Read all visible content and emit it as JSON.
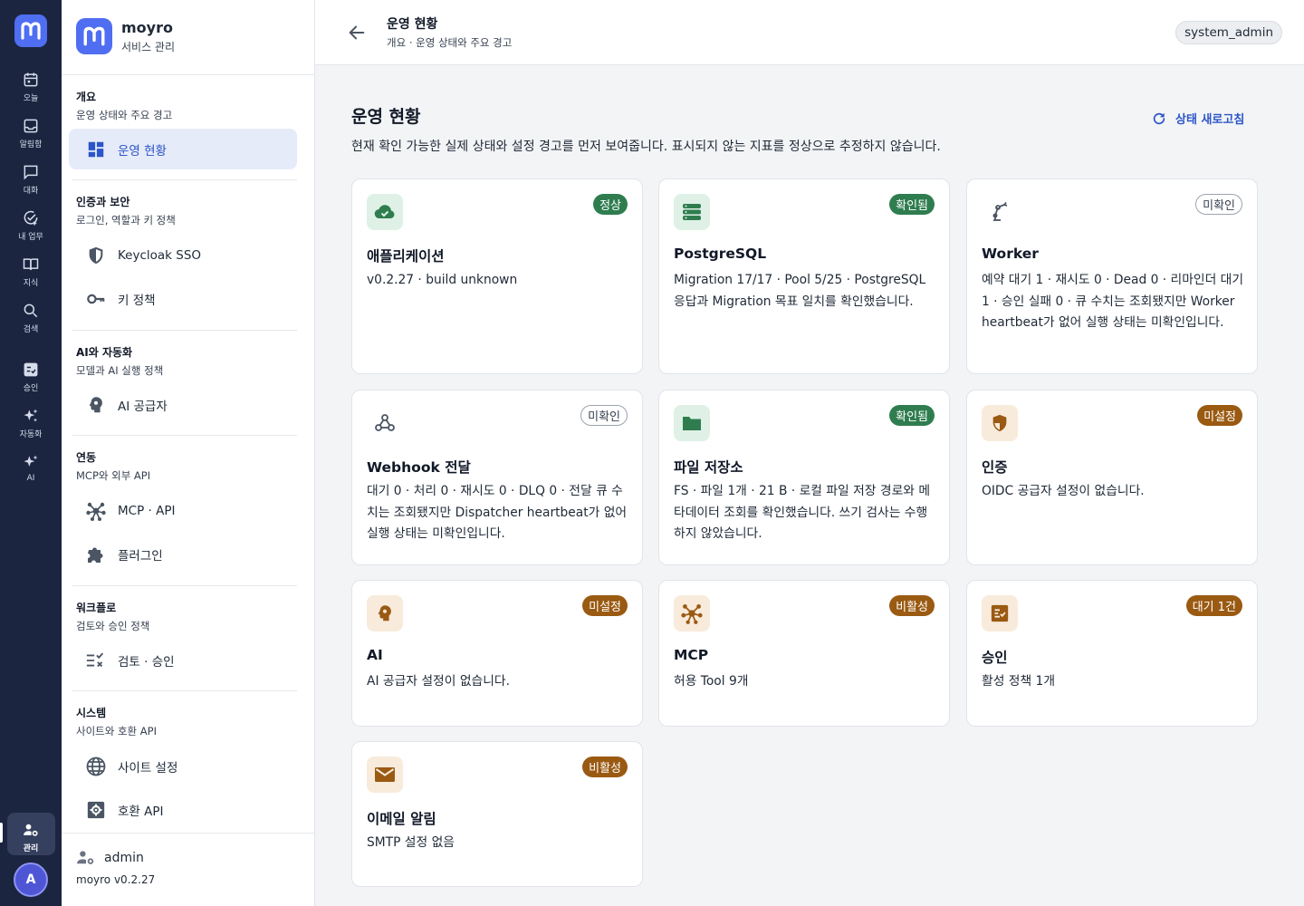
{
  "rail": {
    "items": [
      {
        "label": "오늘",
        "icon": "calendar-icon"
      },
      {
        "label": "알림함",
        "icon": "inbox-icon"
      },
      {
        "label": "대화",
        "icon": "chat-icon"
      },
      {
        "label": "내 업무",
        "icon": "task-check-icon"
      },
      {
        "label": "지식",
        "icon": "book-icon"
      },
      {
        "label": "검색",
        "icon": "search-icon"
      },
      {
        "label": "승인",
        "icon": "approval-icon"
      },
      {
        "label": "자동화",
        "icon": "sparkles-icon"
      },
      {
        "label": "AI",
        "icon": "ai-sparkle-icon"
      },
      {
        "label": "관리",
        "icon": "admin-gear-icon"
      }
    ],
    "avatar_letter": "A"
  },
  "sidebar": {
    "brand_name": "moyro",
    "brand_sub": "서비스 관리",
    "sections": [
      {
        "title": "개요",
        "sub": "운영 상태와 주요 경고",
        "items": [
          {
            "label": "운영 현황",
            "icon": "dashboard-icon",
            "active": true
          }
        ]
      },
      {
        "title": "인증과 보안",
        "sub": "로그인, 역할과 키 정책",
        "items": [
          {
            "label": "Keycloak SSO",
            "icon": "shield-icon"
          },
          {
            "label": "키 정책",
            "icon": "key-icon"
          }
        ]
      },
      {
        "title": "AI와 자동화",
        "sub": "모델과 AI 실행 정책",
        "items": [
          {
            "label": "AI 공급자",
            "icon": "ai-head-icon"
          }
        ]
      },
      {
        "title": "연동",
        "sub": "MCP와 외부 API",
        "items": [
          {
            "label": "MCP · API",
            "icon": "hub-icon"
          },
          {
            "label": "플러그인",
            "icon": "puzzle-icon"
          }
        ]
      },
      {
        "title": "워크플로",
        "sub": "검토와 승인 정책",
        "items": [
          {
            "label": "검토 · 승인",
            "icon": "checklist-icon"
          }
        ]
      },
      {
        "title": "시스템",
        "sub": "사이트와 호환 API",
        "items": [
          {
            "label": "사이트 설정",
            "icon": "globe-icon"
          },
          {
            "label": "호환 API",
            "icon": "settings-box-icon"
          }
        ]
      }
    ],
    "footer_user": "admin",
    "footer_version": "moyro v0.2.27"
  },
  "header": {
    "title": "운영 현황",
    "breadcrumb": "개요 · 운영 상태와 주요 경고",
    "role": "system_admin"
  },
  "main": {
    "title": "운영 현황",
    "description": "현재 확인 가능한 실제 상태와 설정 경고를 먼저 보여줍니다. 표시되지 않는 지표를 정상으로 추정하지 않습니다.",
    "refresh_label": "상태 새로고침",
    "cards": [
      {
        "title": "애플리케이션",
        "body": "v0.2.27 · build unknown",
        "badge": "정상",
        "badge_style": "green",
        "icon": "cloud-check-icon"
      },
      {
        "title": "PostgreSQL",
        "body": "Migration 17/17 · Pool 5/25 · PostgreSQL 응답과 Migration 목표 일치를 확인했습니다.",
        "badge": "확인됨",
        "badge_style": "green",
        "icon": "database-icon"
      },
      {
        "title": "Worker",
        "body": "예약 대기 1 · 재시도 0 · Dead 0 · 리마인더 대기 1 · 승인 실패 0 · 큐 수치는 조회됐지만 Worker heartbeat가 없어 실행 상태는 미확인입니다.",
        "badge": "미확인",
        "badge_style": "outline",
        "icon": "robot-arm-icon"
      },
      {
        "title": "Webhook 전달",
        "body": "대기 0 · 처리 0 · 재시도 0 · DLQ 0 · 전달 큐 수치는 조회됐지만 Dispatcher heartbeat가 없어 실행 상태는 미확인입니다.",
        "badge": "미확인",
        "badge_style": "outline",
        "icon": "webhook-icon"
      },
      {
        "title": "파일 저장소",
        "body": "FS · 파일 1개 · 21 B · 로컬 파일 저장 경로와 메타데이터 조회를 확인했습니다. 쓰기 검사는 수행하지 않았습니다.",
        "badge": "확인됨",
        "badge_style": "green",
        "icon": "folder-icon"
      },
      {
        "title": "인증",
        "body": "OIDC 공급자 설정이 없습니다.",
        "badge": "미설정",
        "badge_style": "amber",
        "icon": "shield-half-icon"
      },
      {
        "title": "AI",
        "body": "AI 공급자 설정이 없습니다.",
        "badge": "미설정",
        "badge_style": "amber",
        "icon": "ai-head-icon"
      },
      {
        "title": "MCP",
        "body": "허용 Tool 9개",
        "badge": "비활성",
        "badge_style": "amber",
        "icon": "hub-icon"
      },
      {
        "title": "승인",
        "body": "활성 정책 1개",
        "badge": "대기 1건",
        "badge_style": "amber",
        "icon": "approval-list-icon"
      },
      {
        "title": "이메일 알림",
        "body": "SMTP 설정 없음",
        "badge": "비활성",
        "badge_style": "amber",
        "icon": "mail-icon"
      }
    ]
  },
  "colors": {
    "rail_bg": "#1b2540",
    "brand": "#4f6ef2",
    "accent_blue": "#2b55c9",
    "ok_green": "#2f7d4f",
    "warn_amber": "#9a5a12"
  }
}
